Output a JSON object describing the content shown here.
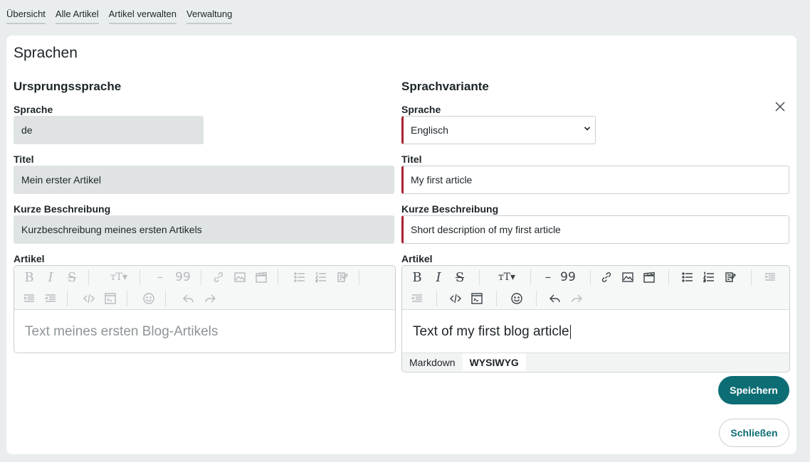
{
  "nav": [
    "Übersicht",
    "Alle Artikel",
    "Artikel verwalten",
    "Verwaltung"
  ],
  "page_title": "Sprachen",
  "origin": {
    "heading": "Ursprungssprache",
    "language_label": "Sprache",
    "language_value": "de",
    "title_label": "Titel",
    "title_value": "Mein erster Artikel",
    "short_label": "Kurze Beschreibung",
    "short_value": "Kurzbeschreibung meines ersten Artikels",
    "article_label": "Artikel",
    "article_text": "Text meines ersten Blog-Artikels"
  },
  "variant": {
    "heading": "Sprachvariante",
    "language_label": "Sprache",
    "language_value": "Englisch",
    "title_label": "Titel",
    "title_value": "My first article",
    "short_label": "Kurze Beschreibung",
    "short_value": "Short description of my first article",
    "article_label": "Artikel",
    "article_text": "Text of my first blog article",
    "mode_tabs": [
      "Markdown",
      "WYSIWYG"
    ],
    "active_mode": "WYSIWYG"
  },
  "toolbar_glyphs": {
    "bold": "B",
    "italic": "I",
    "strike": "S",
    "heading": "тT▾",
    "hr": "–",
    "quote": "99"
  },
  "buttons": {
    "save": "Speichern",
    "close": "Schließen"
  },
  "colors": {
    "accent": "#0d6d75",
    "required": "#a8232e",
    "readonly_bg": "#dfe3e4",
    "disabled_icon": "#b5bbbd",
    "enabled_icon": "#3b4347"
  }
}
